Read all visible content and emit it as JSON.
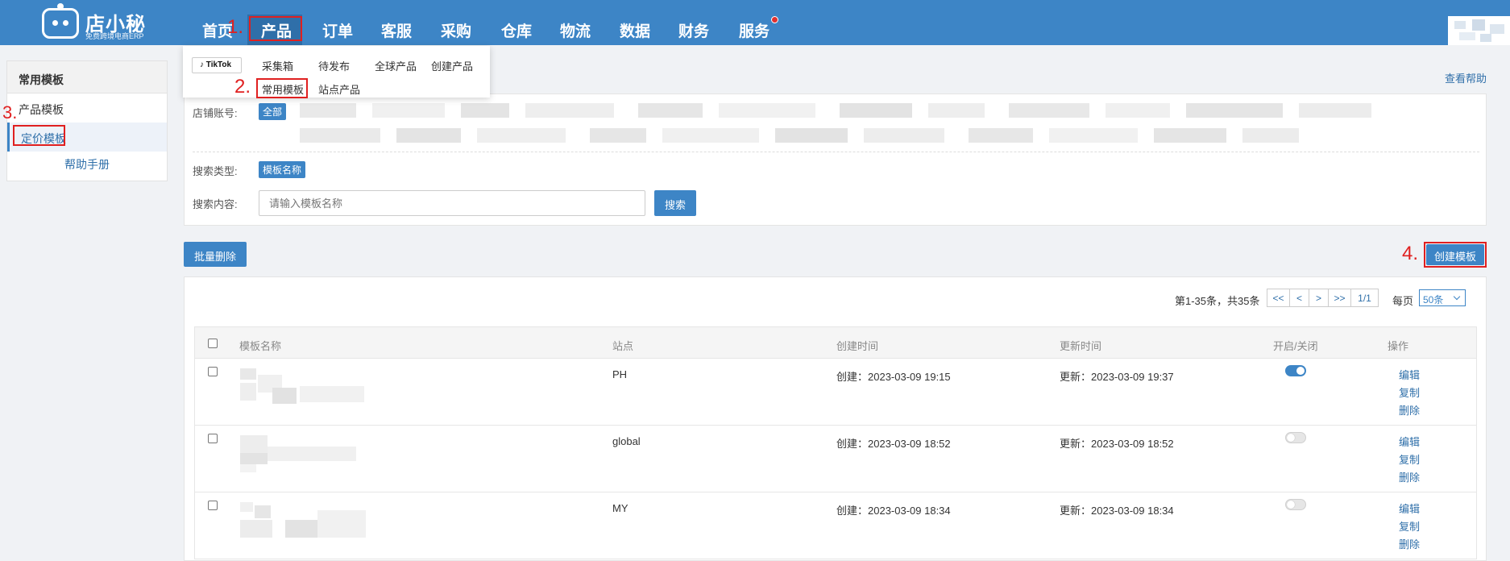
{
  "brand": {
    "name": "店小秘",
    "tagline": "免费跨境电商ERP"
  },
  "nav": {
    "items": [
      {
        "label": "首页",
        "active": false
      },
      {
        "label": "产品",
        "active": true
      },
      {
        "label": "订单",
        "active": false
      },
      {
        "label": "客服",
        "active": false
      },
      {
        "label": "采购",
        "active": false
      },
      {
        "label": "仓库",
        "active": false
      },
      {
        "label": "物流",
        "active": false
      },
      {
        "label": "数据",
        "active": false
      },
      {
        "label": "财务",
        "active": false
      },
      {
        "label": "服务",
        "active": false,
        "badge": true
      }
    ]
  },
  "annotations": {
    "a1": "1.",
    "a2": "2.",
    "a3": "3.",
    "a4": "4."
  },
  "dropdown": {
    "platform_logo": "TikTok",
    "row1": [
      "采集箱",
      "待发布",
      "全球产品",
      "创建产品"
    ],
    "row2": [
      "常用模板",
      "站点产品"
    ]
  },
  "sidebar": {
    "heading": "常用模板",
    "items": [
      {
        "label": "产品模板",
        "active": false
      },
      {
        "label": "定价模板",
        "active": true
      }
    ],
    "help": "帮助手册"
  },
  "help_link": "查看帮助",
  "filters": {
    "shop_label": "店铺账号:",
    "shop_all": "全部",
    "type_label": "搜索类型:",
    "type_value": "模板名称",
    "content_label": "搜索内容:",
    "content_placeholder": "请输入模板名称",
    "search_button": "搜索"
  },
  "actions": {
    "batch_delete": "批量删除",
    "create_template": "创建模板"
  },
  "pager": {
    "summary": "第1-35条，共35条",
    "first": "<<",
    "prev": "<",
    "next": ">",
    "last": ">>",
    "page": "1/1",
    "per_page_label": "每页",
    "per_page_value": "50条"
  },
  "table": {
    "headers": [
      "模板名称",
      "站点",
      "创建时间",
      "更新时间",
      "开启/关闭",
      "操作"
    ],
    "rows": [
      {
        "site": "PH",
        "created": "创建：2023-03-09 19:15",
        "updated": "更新：2023-03-09 19:37",
        "enabled": true
      },
      {
        "site": "global",
        "created": "创建：2023-03-09 18:52",
        "updated": "更新：2023-03-09 18:52",
        "enabled": false
      },
      {
        "site": "MY",
        "created": "创建：2023-03-09 18:34",
        "updated": "更新：2023-03-09 18:34",
        "enabled": false
      }
    ],
    "ops": [
      "编辑",
      "复制",
      "删除"
    ]
  },
  "colors": {
    "primary": "#3d85c6",
    "annotation_red": "#e02020",
    "link": "#2f6fa9"
  }
}
